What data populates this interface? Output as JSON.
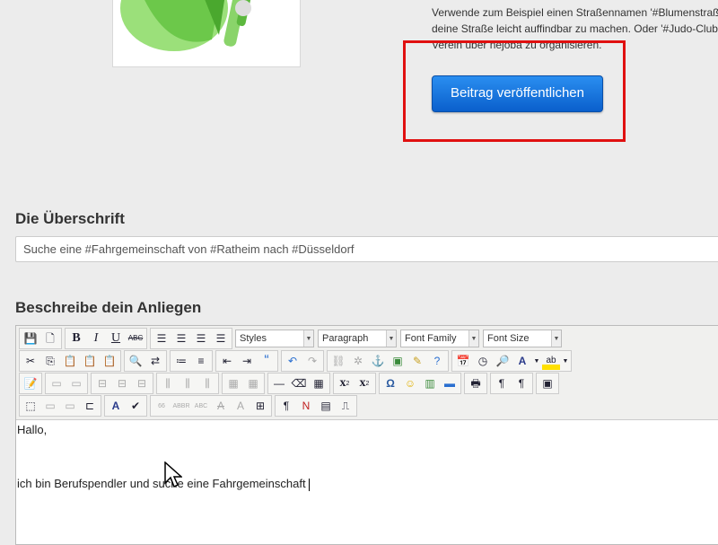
{
  "intro": {
    "line1": "Verwende zum Beispiel einen Straßennamen '#Blumenstraße'",
    "line2": "deine Straße leicht auffindbar zu machen. Oder '#Judo-Club'",
    "line3": "Verein über nejoba zu organisieren."
  },
  "publish": {
    "label": "Beitrag veröffentlichen"
  },
  "heading_title": "Die Überschrift",
  "title_input": {
    "value": "Suche eine #Fahrgemeinschaft von #Ratheim nach #Düsseldorf"
  },
  "heading_desc": "Beschreibe dein Anliegen",
  "editor": {
    "styles": "Styles",
    "paragraph": "Paragraph",
    "font_family": "Font Family",
    "font_size": "Font Size",
    "line1": "Hallo,",
    "line2": "ich bin Berufspendler und suche eine Fahrgemeinschaft"
  },
  "colors": {
    "button": "#1a73e0",
    "highlight": "#e01010",
    "megaphone": "#7ed957"
  }
}
